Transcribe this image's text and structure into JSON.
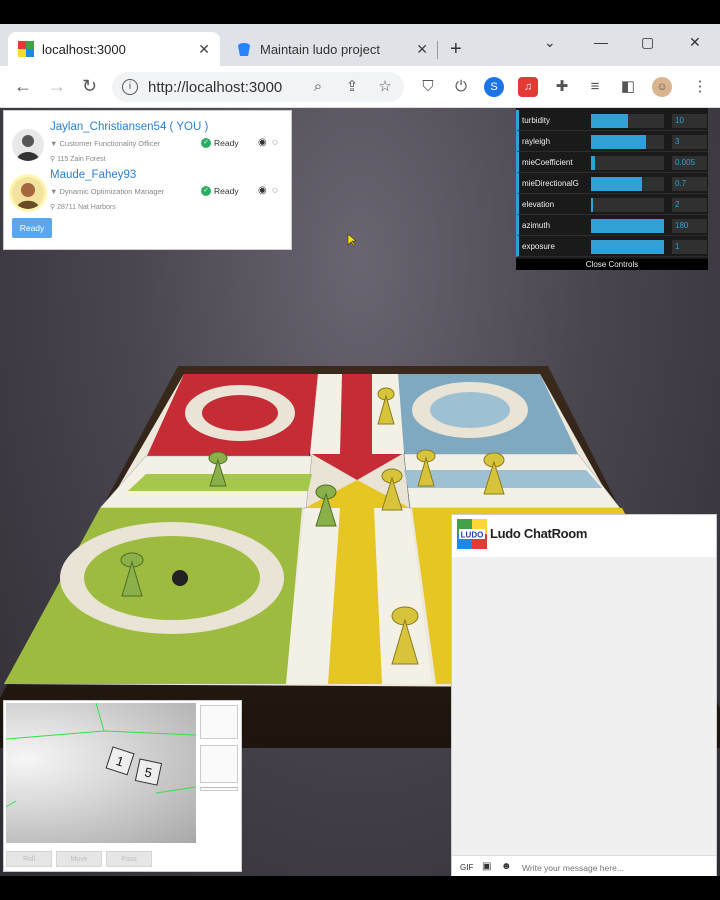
{
  "browser": {
    "tabs": [
      {
        "title": "localhost:3000",
        "active": true
      },
      {
        "title": "Maintain ludo project",
        "active": false
      }
    ],
    "url": "http://localhost:3000"
  },
  "players": [
    {
      "name": "Jaylan_Christiansen54 ( YOU )",
      "role": "Customer Functionality Officer",
      "address": "115 Zain Forest",
      "status": "Ready"
    },
    {
      "name": "Maude_Fahey93",
      "role": "Dynamic Optimization Manager",
      "address": "28711 Nat Harbors",
      "status": "Ready"
    }
  ],
  "ready_button": "Ready",
  "controls": {
    "accent": "#2fa1d6",
    "rows": [
      {
        "label": "turbidity",
        "value": "10",
        "fill": 0.5
      },
      {
        "label": "rayleigh",
        "value": "3",
        "fill": 0.75
      },
      {
        "label": "mieCoefficient",
        "value": "0.005",
        "fill": 0.05
      },
      {
        "label": "mieDirectionalG",
        "value": "0.7",
        "fill": 0.7
      },
      {
        "label": "elevation",
        "value": "2",
        "fill": 0.03
      },
      {
        "label": "azimuth",
        "value": "180",
        "fill": 1.0
      },
      {
        "label": "exposure",
        "value": "1",
        "fill": 1.0
      }
    ],
    "close_label": "Close Controls"
  },
  "dice": {
    "values": [
      "1",
      "5"
    ],
    "buttons": [
      "Roll",
      "Move",
      "Pass"
    ]
  },
  "chat": {
    "title": "Ludo ChatRoom",
    "logo_text": "LUDO",
    "gif_label": "GIF",
    "input_placeholder": "Write your message here..."
  }
}
